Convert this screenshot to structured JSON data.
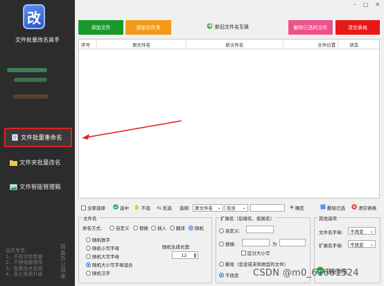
{
  "sidebar": {
    "logo_char": "改",
    "app_title": "文件批量改名高手",
    "nav": [
      {
        "label": "文件批量重命名",
        "icon": "document-icon"
      },
      {
        "label": "文件夹批量改名",
        "icon": "folder-icon"
      },
      {
        "label": "文件智能管理箱",
        "icon": "image-icon"
      }
    ],
    "note_lines": [
      "会员专享:",
      "1、不限文件数量",
      "2、不限电脑使用",
      "3、免费技术支持",
      "4、永久免费升级"
    ],
    "note_side": "提高办公效率"
  },
  "window": {
    "minimize": "–",
    "maximize": "□",
    "close": "✕"
  },
  "toolbar": {
    "add_file": "添加文件",
    "add_folder": "添加文件夹",
    "swap_name": "新旧文件名互换",
    "delete_selected": "删除已选的文件",
    "clear_table": "清空表格",
    "colors": {
      "green": "#1a9a2a",
      "orange": "#f39a1a",
      "pink": "#f0508a",
      "red": "#e81818"
    }
  },
  "table": {
    "columns": [
      "序号",
      "原文件名",
      "新文件名",
      "文件位置",
      "状态"
    ]
  },
  "selection_bar": {
    "select_all": "全部选择",
    "select": "选中",
    "deselect": "不选",
    "invert": "反选",
    "choose_label": "选择:",
    "field_value": "原文件名",
    "match_value": "包含",
    "confirm": "确定",
    "delete_selected": "删除已选",
    "clear_table": "清空表格"
  },
  "filename_group": {
    "title": "文件名",
    "naming_label": "命名方式:",
    "modes": [
      {
        "label": "自定义",
        "selected": false
      },
      {
        "label": "替换",
        "selected": false
      },
      {
        "label": "插入",
        "selected": false
      },
      {
        "label": "翻译",
        "selected": false
      },
      {
        "label": "随机",
        "selected": true
      }
    ],
    "random_options": [
      {
        "label": "随机数字",
        "selected": false
      },
      {
        "label": "随机小写字母",
        "selected": false
      },
      {
        "label": "随机大写字母",
        "selected": false
      },
      {
        "label": "随机大小写字母混合",
        "selected": true
      },
      {
        "label": "随机汉字",
        "selected": false
      }
    ],
    "length_label": "随机生成长度:",
    "length_value": "12"
  },
  "ext_group": {
    "title": "扩展名（后缀名、拓展名）",
    "custom": "自定义:",
    "replace": "替换:",
    "to": "为",
    "case_sensitive": "区分大小写",
    "delete": "删除（会变成未知类型的文件）",
    "unchanged": "不改变"
  },
  "other_group": {
    "title": "其他选项",
    "filename_case_label": "文件名字母:",
    "filename_case_value": "不改变",
    "ext_case_label": "扩展名字母:",
    "ext_case_value": "不改变",
    "start_button": "开始命名"
  },
  "watermark": "CSDN @m0_61661524"
}
